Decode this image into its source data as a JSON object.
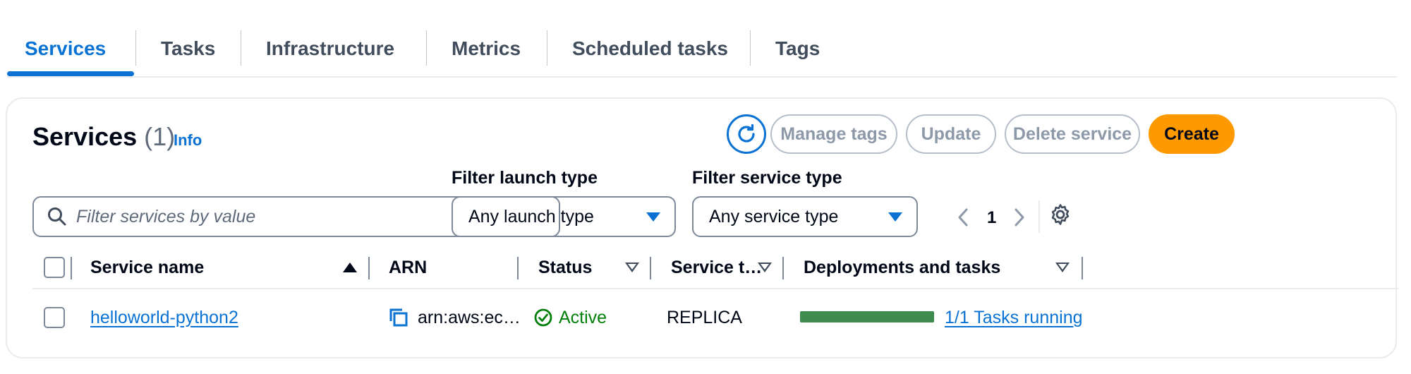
{
  "tabs": [
    {
      "label": "Services",
      "active": true
    },
    {
      "label": "Tasks"
    },
    {
      "label": "Infrastructure"
    },
    {
      "label": "Metrics"
    },
    {
      "label": "Scheduled tasks"
    },
    {
      "label": "Tags"
    }
  ],
  "header": {
    "title": "Services",
    "count": "(1)",
    "info_link": "Info"
  },
  "actions": {
    "refresh_icon": "refresh-icon",
    "manage_tags": "Manage tags",
    "update": "Update",
    "delete_service": "Delete service",
    "create": "Create"
  },
  "filters": {
    "search_placeholder": "Filter services by value",
    "launch_type_label": "Filter launch type",
    "launch_type_value": "Any launch type",
    "service_type_label": "Filter service type",
    "service_type_value": "Any service type"
  },
  "pagination": {
    "current_page": "1"
  },
  "table": {
    "columns": [
      "Service name",
      "ARN",
      "Status",
      "Service t…",
      "Deployments and tasks"
    ],
    "rows": [
      {
        "service_name": "helloworld-python2",
        "arn": "arn:aws:ec…",
        "status": "Active",
        "service_type": "REPLICA",
        "tasks_running_fraction": 1.0,
        "tasks_label": "1/1 Tasks running"
      }
    ]
  },
  "colors": {
    "accent": "#0972d3",
    "primary_button": "#ff9900",
    "status_active": "#037f0c",
    "progress": "#3d8b4e"
  }
}
